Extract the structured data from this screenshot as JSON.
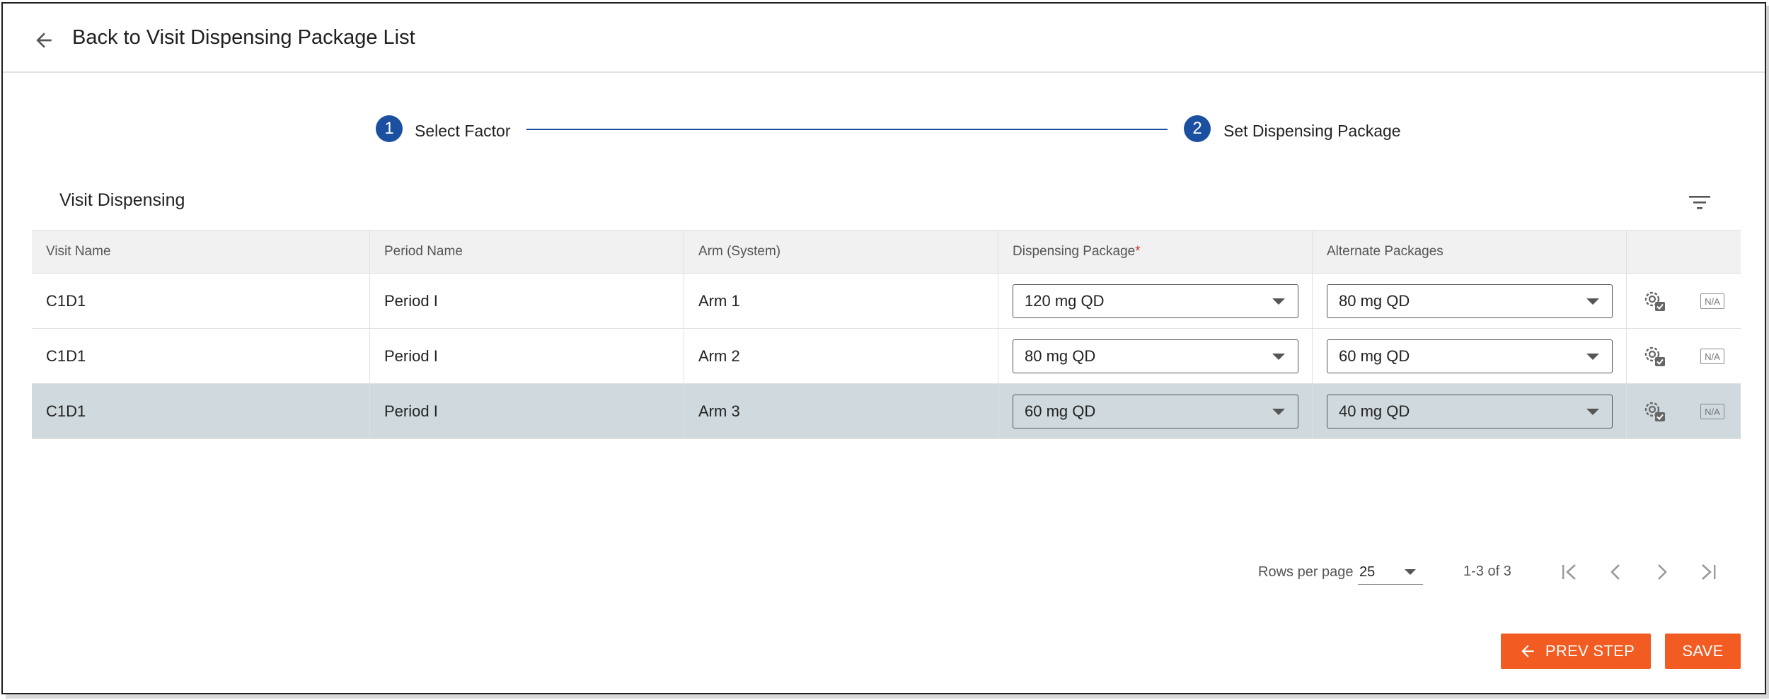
{
  "header": {
    "back_label": "Back to Visit Dispensing Package List"
  },
  "stepper": {
    "steps": [
      {
        "number": "1",
        "label": "Select Factor"
      },
      {
        "number": "2",
        "label": "Set Dispensing Package"
      }
    ],
    "accent": "#1b4fa0"
  },
  "section": {
    "title": "Visit Dispensing"
  },
  "table": {
    "columns": [
      "Visit Name",
      "Period Name",
      "Arm (System)",
      "Dispensing Package",
      "Alternate Packages"
    ],
    "required_marker": "*",
    "rows": [
      {
        "visit": "C1D1",
        "period": "Period I",
        "arm": "Arm 1",
        "dispensing": "120 mg QD",
        "alternate": "80 mg QD",
        "na": "N/A"
      },
      {
        "visit": "C1D1",
        "period": "Period I",
        "arm": "Arm 2",
        "dispensing": "80 mg QD",
        "alternate": "60 mg QD",
        "na": "N/A"
      },
      {
        "visit": "C1D1",
        "period": "Period I",
        "arm": "Arm 3",
        "dispensing": "60 mg QD",
        "alternate": "40 mg QD",
        "na": "N/A"
      }
    ],
    "selected_row": 2
  },
  "pagination": {
    "rows_per_page_label": "Rows per page",
    "rows_per_page": "25",
    "range": "1-3 of 3"
  },
  "footer": {
    "prev_label": "PREV STEP",
    "save_label": "SAVE",
    "button_color": "#f25c22"
  }
}
